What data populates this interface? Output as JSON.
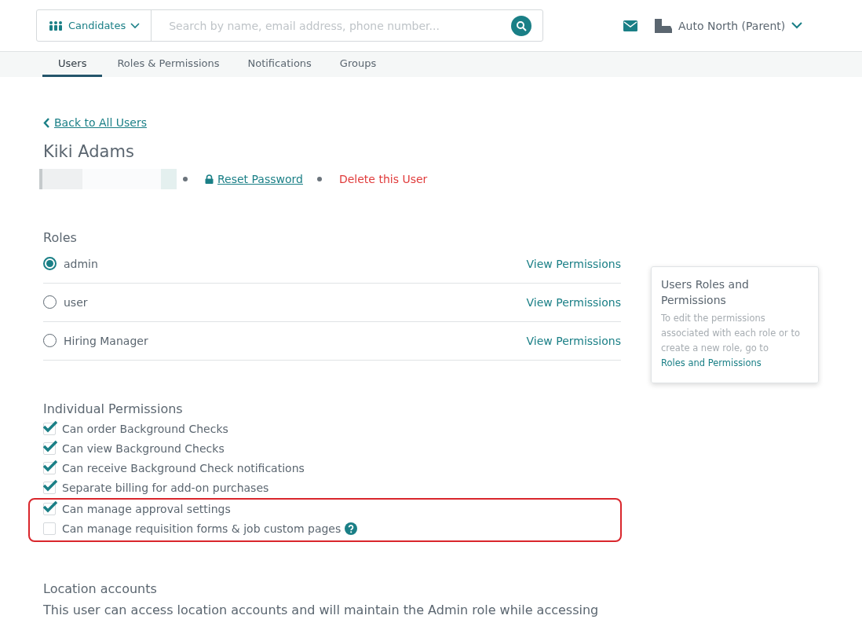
{
  "header": {
    "search_scope": "Candidates",
    "search": {
      "placeholder": "Search by name, email address, phone number..."
    },
    "account": "Auto North (Parent)"
  },
  "tabs": [
    {
      "label": "Users",
      "selected": true
    },
    {
      "label": "Roles & Permissions",
      "selected": false
    },
    {
      "label": "Notifications",
      "selected": false
    },
    {
      "label": "Groups",
      "selected": false
    }
  ],
  "back_link": "Back to All Users",
  "user": {
    "name": "Kiki Adams",
    "reset_password": "Reset Password",
    "delete": "Delete this User"
  },
  "roles": {
    "title": "Roles",
    "items": [
      {
        "label": "admin",
        "selected": true,
        "link": "View Permissions"
      },
      {
        "label": "user",
        "selected": false,
        "link": "View Permissions"
      },
      {
        "label": "Hiring Manager",
        "selected": false,
        "link": "View Permissions"
      }
    ]
  },
  "info_card": {
    "title": "Users Roles and Permissions",
    "text": "To edit the permissions associated with each role or to create a new role, go to",
    "link": "Roles and Permissions"
  },
  "permissions": {
    "title": "Individual Permissions",
    "items": [
      {
        "label": "Can order Background Checks",
        "checked": true,
        "highlighted": false,
        "help": false
      },
      {
        "label": "Can view Background Checks",
        "checked": true,
        "highlighted": false,
        "help": false
      },
      {
        "label": "Can receive Background Check notifications",
        "checked": true,
        "highlighted": false,
        "help": false
      },
      {
        "label": "Separate billing for add-on purchases",
        "checked": true,
        "highlighted": false,
        "help": false
      },
      {
        "label": "Can manage approval settings",
        "checked": true,
        "highlighted": true,
        "help": false
      },
      {
        "label": "Can manage requisition forms & job custom pages",
        "checked": false,
        "highlighted": true,
        "help": true
      }
    ]
  },
  "location_accounts": {
    "title": "Location accounts",
    "text": "This user can access location accounts and will maintain the Admin role while accessing"
  }
}
